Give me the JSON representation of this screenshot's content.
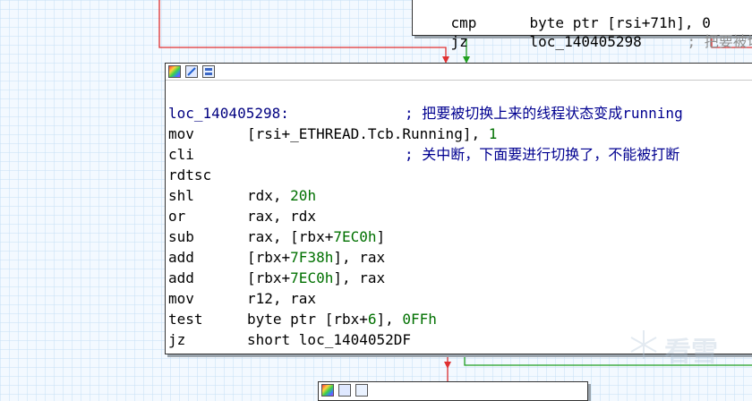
{
  "top_node": {
    "lines": [
      {
        "mnemonic": "cmp",
        "operands": "byte ptr [rsi+71h], 0",
        "comment": ""
      },
      {
        "mnemonic": "jz",
        "operands": "loc_140405298",
        "comment": "; 把要被切换"
      }
    ]
  },
  "main_node": {
    "label_line": {
      "label": "loc_140405298:",
      "comment": "; 把要被切换上来的线程状态变成running"
    },
    "instructions": [
      {
        "mnemonic": "mov",
        "op_a": "[rsi+_ETHREAD.Tcb.Running], ",
        "op_num": "1",
        "op_b": "",
        "comment": ""
      },
      {
        "mnemonic": "cli",
        "op_a": "",
        "op_num": "",
        "op_b": "",
        "comment": "; 关中断，下面要进行切换了，不能被打断"
      },
      {
        "mnemonic": "rdtsc",
        "op_a": "",
        "op_num": "",
        "op_b": "",
        "comment": ""
      },
      {
        "mnemonic": "shl",
        "op_a": "rdx, ",
        "op_num": "20h",
        "op_b": "",
        "comment": ""
      },
      {
        "mnemonic": "or",
        "op_a": "rax, rdx",
        "op_num": "",
        "op_b": "",
        "comment": ""
      },
      {
        "mnemonic": "sub",
        "op_a": "rax, [rbx+",
        "op_num": "7EC0h",
        "op_b": "]",
        "comment": ""
      },
      {
        "mnemonic": "add",
        "op_a": "[rbx+",
        "op_num": "7F38h",
        "op_b": "], rax",
        "comment": ""
      },
      {
        "mnemonic": "add",
        "op_a": "[rbx+",
        "op_num": "7EC0h",
        "op_b": "], rax",
        "comment": ""
      },
      {
        "mnemonic": "mov",
        "op_a": "r12, rax",
        "op_num": "",
        "op_b": "",
        "comment": ""
      },
      {
        "mnemonic": "test",
        "op_a": "byte ptr [rbx+",
        "op_num": "6",
        "op_b": "], ",
        "op_num2": "0FFh",
        "comment": ""
      },
      {
        "mnemonic": "jz",
        "op_a": "short loc_1404052DF",
        "op_num": "",
        "op_b": "",
        "comment": ""
      }
    ]
  },
  "toolbar_icons": [
    "color-palette-icon",
    "edit-node-icon",
    "graph-view-icon"
  ],
  "watermark": {
    "text": "看雪"
  },
  "colors": {
    "edge_false": "#e03030",
    "edge_true": "#20a020",
    "background": "#f3f9ff"
  }
}
